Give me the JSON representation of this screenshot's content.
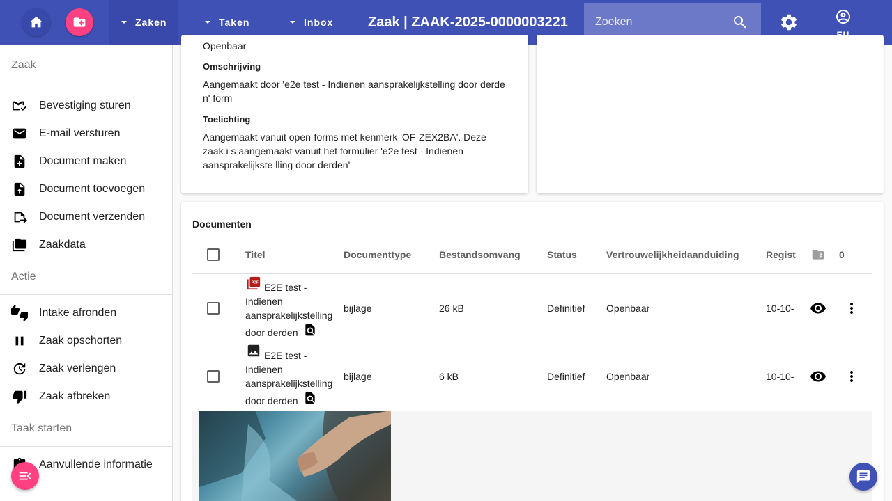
{
  "topbar": {
    "menus": [
      "Zaken",
      "Taken",
      "Inbox"
    ],
    "title": "Zaak | ZAAK-2025-0000003221",
    "search_placeholder": "Zoeken",
    "user_initials": "EU"
  },
  "sidebar": {
    "section_zaak": "Zaak",
    "zaak_items": [
      "Bevestiging sturen",
      "E-mail versturen",
      "Document maken",
      "Document toevoegen",
      "Document verzenden",
      "Zaakdata"
    ],
    "section_actie": "Actie",
    "actie_items": [
      "Intake afronden",
      "Zaak opschorten",
      "Zaak verlengen",
      "Zaak afbreken"
    ],
    "section_taak": "Taak starten",
    "taak_items": [
      "Aanvullende informatie"
    ]
  },
  "details": {
    "vertrouwelijkheid_value": "Openbaar",
    "omschrijving_label": "Omschrijving",
    "omschrijving_value": "Aangemaakt door 'e2e test - Indienen aansprakelijkstelling door derde n' form",
    "toelichting_label": "Toelichting",
    "toelichting_value": "Aangemaakt vanuit open-forms met kenmerk 'OF-ZEX2BA'. Deze zaak i s aangemaakt vanuit het formulier 'e2e test - Indienen aansprakelijkste lling door derden'"
  },
  "documents": {
    "title": "Documenten",
    "columns": [
      "Titel",
      "Documenttype",
      "Bestandsomvang",
      "Status",
      "Vertrouwelijkheidaanduiding",
      "Regist"
    ],
    "count": "0",
    "rows": [
      {
        "icon": "pdf-icon",
        "title": "E2E test - Indienen aansprakelijkstelling door derden",
        "type": "bijlage",
        "size": "26 kB",
        "status": "Definitief",
        "confidentiality": "Openbaar",
        "date": "10-10-"
      },
      {
        "icon": "image-icon",
        "title": "E2E test - Indienen aansprakelijkstelling door derden",
        "type": "bijlage",
        "size": "6 kB",
        "status": "Definitief",
        "confidentiality": "Openbaar",
        "date": "10-10-"
      }
    ]
  },
  "colors": {
    "primary": "#3f51b5",
    "accent": "#ff4081",
    "pdf": "#b71c1c"
  }
}
